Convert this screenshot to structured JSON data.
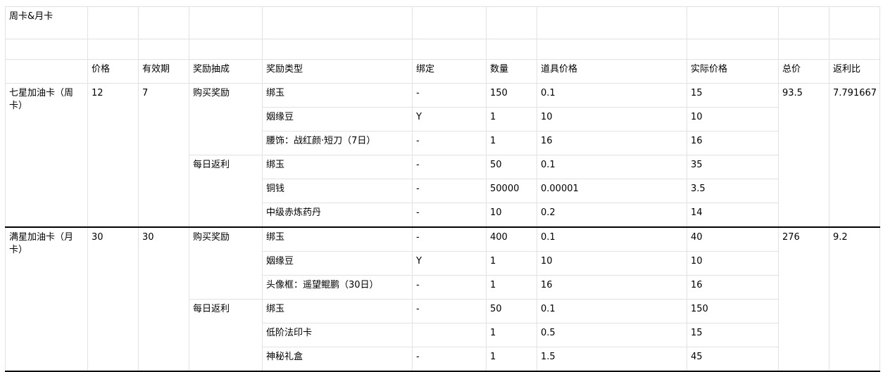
{
  "title": "周卡&月卡",
  "headers": [
    "价格",
    "有效期",
    "奖励抽成",
    "奖励类型",
    "绑定",
    "数量",
    "道具价格",
    "实际价格",
    "总价",
    "返利比"
  ],
  "cards": [
    {
      "name": "七星加油卡（周卡）",
      "price": "12",
      "validity": "7",
      "total": "93.5",
      "rebate": "7.791667",
      "groups": [
        {
          "label": "购买奖励",
          "rows": [
            {
              "type": "绑玉",
              "bind": "-",
              "qty": "150",
              "unit_price": "0.1",
              "actual": "15"
            },
            {
              "type": "姻缘豆",
              "bind": "Y",
              "qty": "1",
              "unit_price": "10",
              "actual": "10"
            },
            {
              "type": "腰饰：战红颜·短刀（7日）",
              "bind": "-",
              "qty": "1",
              "unit_price": "16",
              "actual": "16"
            }
          ]
        },
        {
          "label": "每日返利",
          "rows": [
            {
              "type": "绑玉",
              "bind": "-",
              "qty": "50",
              "unit_price": "0.1",
              "actual": "35"
            },
            {
              "type": "铜钱",
              "bind": "-",
              "qty": "50000",
              "unit_price": "0.00001",
              "actual": "3.5"
            },
            {
              "type": "中级赤炼药丹",
              "bind": "-",
              "qty": "10",
              "unit_price": "0.2",
              "actual": "14"
            }
          ]
        }
      ]
    },
    {
      "name": "满星加油卡（月卡）",
      "price": "30",
      "validity": "30",
      "total": "276",
      "rebate": "9.2",
      "groups": [
        {
          "label": "购买奖励",
          "rows": [
            {
              "type": "绑玉",
              "bind": "-",
              "qty": "400",
              "unit_price": "0.1",
              "actual": "40"
            },
            {
              "type": "姻缘豆",
              "bind": "Y",
              "qty": "1",
              "unit_price": "10",
              "actual": "10"
            },
            {
              "type": "头像框：遥望鲲鹏（30日）",
              "bind": "-",
              "qty": "1",
              "unit_price": "16",
              "actual": "16"
            }
          ]
        },
        {
          "label": "每日返利",
          "rows": [
            {
              "type": "绑玉",
              "bind": "-",
              "qty": "50",
              "unit_price": "0.1",
              "actual": "150"
            },
            {
              "type": "低阶法印卡",
              "bind": "",
              "qty": "1",
              "unit_price": "0.5",
              "actual": "15"
            },
            {
              "type": "神秘礼盒",
              "bind": "-",
              "qty": "1",
              "unit_price": "1.5",
              "actual": "45"
            }
          ]
        }
      ]
    }
  ]
}
